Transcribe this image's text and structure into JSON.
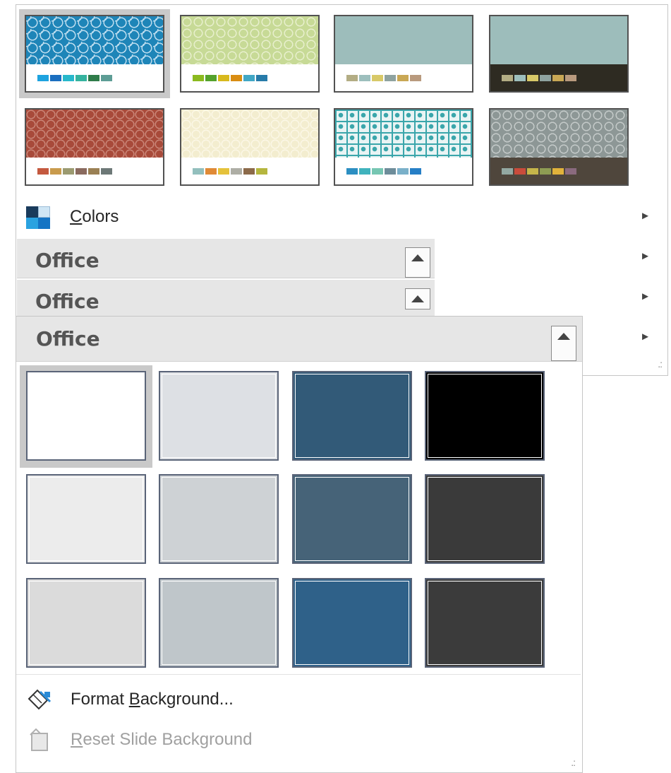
{
  "variants": {
    "thumbnails": [
      {
        "name": "variant-blue-circles",
        "pattern": "blue",
        "swatches": [
          "#1ea3df",
          "#1b6fc0",
          "#27b8cb",
          "#35b39f",
          "#2f7c4a",
          "#5d9d95"
        ],
        "dark": false
      },
      {
        "name": "variant-green-lattice",
        "pattern": "green",
        "swatches": [
          "#8bba1f",
          "#54a22c",
          "#d8b91d",
          "#d98d12",
          "#41a7c5",
          "#277ba9"
        ],
        "dark": false
      },
      {
        "name": "variant-teal-plain",
        "pattern": "teal",
        "swatches": [
          "#b3ad84",
          "#9dbfbd",
          "#d8c968",
          "#8fa3a0",
          "#c9a855",
          "#b99a7e"
        ],
        "dark": false
      },
      {
        "name": "variant-teal-dark",
        "pattern": "teal",
        "swatches": [
          "#b3ad84",
          "#9dbfbd",
          "#d8c968",
          "#8fa3a0",
          "#c9a855",
          "#b99a7e"
        ],
        "dark": true,
        "strip": "#2e2b22"
      },
      {
        "name": "variant-red-pattern",
        "pattern": "red",
        "swatches": [
          "#c4593f",
          "#c99b4d",
          "#9b9a70",
          "#8a6a5e",
          "#9a8054",
          "#6d7877"
        ],
        "dark": false
      },
      {
        "name": "variant-cream-pattern",
        "pattern": "cream",
        "swatches": [
          "#93bfbd",
          "#e08a36",
          "#e5c23b",
          "#aeaea5",
          "#8c6a4a",
          "#b5b63e"
        ],
        "dark": false
      },
      {
        "name": "variant-teal-squares",
        "pattern": "teal2",
        "swatches": [
          "#2c8fc2",
          "#40b3bd",
          "#76c6b2",
          "#6e8d9a",
          "#7ab0c9",
          "#267fc6"
        ],
        "dark": false
      },
      {
        "name": "variant-gray-dark",
        "pattern": "gray",
        "swatches": [
          "#93a8a2",
          "#c94b3b",
          "#c5b54a",
          "#8e9c53",
          "#e1b23b",
          "#8a6a7e"
        ],
        "dark": true,
        "strip": "#4f463c"
      }
    ]
  },
  "menu": {
    "colors_label": "Colors",
    "colors_underline": "C",
    "colors_rest": "olors",
    "arrow": "►",
    "office_1": "Office",
    "office_2": "Office",
    "office_3": "Office"
  },
  "background_styles": {
    "header": "Office",
    "swatches": [
      "#ffffff",
      "#dde0e4",
      "#325a78",
      "#000000",
      "#ececec",
      "#ced2d5",
      "#466378",
      "#3a3a3a",
      "#dbdbdb",
      "#bfc6ca",
      "#2f6189",
      "#3b3b3b"
    ],
    "format_background": {
      "u": "B",
      "pre": "Format ",
      "post": "ackground..."
    },
    "reset_background": {
      "u": "R",
      "post": "eset Slide Background"
    }
  },
  "colors": {
    "menu_text": "#262626",
    "disabled_text": "#a0a0a0",
    "header_bg": "#e6e6e6",
    "selection": "#c9c9c9"
  }
}
